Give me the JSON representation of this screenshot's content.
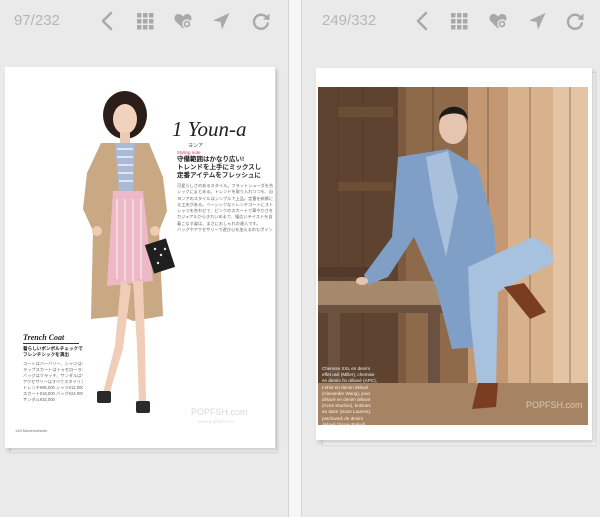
{
  "left_pane": {
    "page_counter": "97/232",
    "page": {
      "title": "1 Youn-a",
      "title_kana": "ヨンア",
      "tag": "Styling note",
      "headline_lines": [
        "守備範囲はかなり広い!",
        "トレンドを上手にミックスし",
        "定番アイテムをフレッシュに"
      ],
      "body_lines": [
        "可愛らしさのあるスタイル。フラットシューズを合わせ",
        "シックにまとめる。トレンドを取り入れつつも、自分らしい",
        "ヨンアのスタイルはシンプルで上品。定番を新鮮に見せ",
        "る工夫がある。ベーシックなトレンチコートにストライプ",
        "シャツを合わせて、ピンクのスカートで華やかさをプラス。",
        "カジュアルからきれいめまで、幅広いテイストを自在に",
        "着こなす姿は、まさにおしゃれの達人です。",
        "バッグやアクセサリーで遊び心を加えるのもポイント。"
      ],
      "section_title": "Trench Coat",
      "section_sub_lines": [
        "着らしいボンボルチェックで",
        "フレンチシックを演出"
      ],
      "section_body_lines": [
        "コートはバーバリー、シャツはミッシェルクラン",
        "ラップスカートはトゥモローランド。",
        "バッグはクラッチ、サンダルはヴィヴィアン。",
        "アクセサリーはすべてスタイリスト私物。",
        "トレンチ¥98,000 シャツ¥12,000",
        "スカート¥18,000 バッグ¥24,000",
        "サンダル¥32,000"
      ],
      "folio": "148 Mademoiselle",
      "watermark": "POPFSH.com",
      "watermark_sub": "www.popfash.com"
    }
  },
  "right_pane": {
    "page_counter": "249/332",
    "page": {
      "caption_lines": [
        "Chemise XXL en denim",
        "effet usé (Miller), chemise",
        "en denim fin délavé (APC),",
        "t-shirt en denim délavé",
        "(Alexander Wang), jean",
        "délavé en denim délavé",
        "(Acne Studios), bottines",
        "en daim (Saint Laurent),",
        "patchwork de denim",
        "délavé (Sonia Rykiel)."
      ],
      "watermark": "POPFSH.com"
    }
  },
  "toolbar_icons": [
    "back-arrow-icon",
    "grid-icon",
    "heart-icon",
    "share-icon",
    "refresh-icon"
  ],
  "colors": {
    "icon": "#a9a9a9",
    "counter": "#b6b6b6",
    "background": "#eaeaea",
    "page": "#ffffff"
  }
}
